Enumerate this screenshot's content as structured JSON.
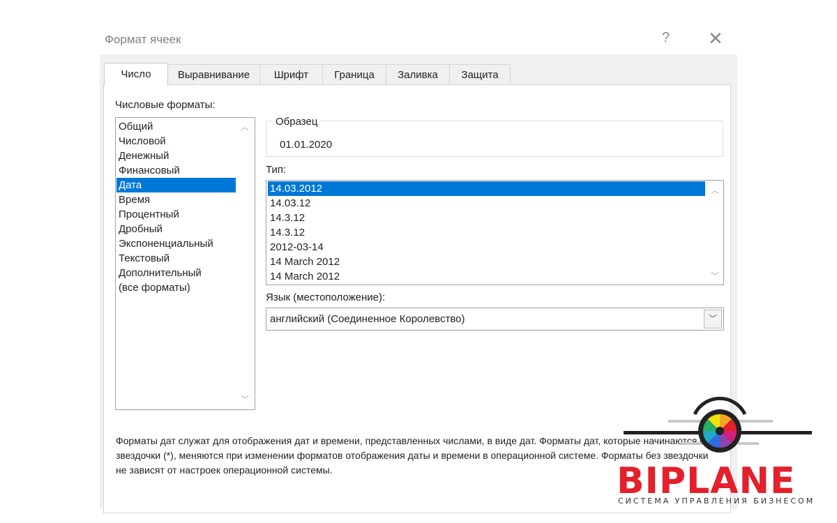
{
  "dialog": {
    "title": "Формат ячеек",
    "help_label": "?",
    "close_label": "✕"
  },
  "tabs": [
    {
      "label": "Число",
      "active": true
    },
    {
      "label": "Выравнивание",
      "active": false
    },
    {
      "label": "Шрифт",
      "active": false
    },
    {
      "label": "Граница",
      "active": false
    },
    {
      "label": "Заливка",
      "active": false
    },
    {
      "label": "Защита",
      "active": false
    }
  ],
  "categories": {
    "label": "Числовые форматы:",
    "items": [
      "Общий",
      "Числовой",
      "Денежный",
      "Финансовый",
      "Дата",
      "Время",
      "Процентный",
      "Дробный",
      "Экспоненциальный",
      "Текстовый",
      "Дополнительный",
      "(все форматы)"
    ],
    "selected": "Дата"
  },
  "sample": {
    "label": "Образец",
    "value": "01.01.2020"
  },
  "type": {
    "label": "Тип:",
    "items": [
      "14.03.2012",
      "14.03.12",
      "14.3.12",
      "14.3.12",
      "2012-03-14",
      "14 March 2012",
      "14 March 2012"
    ],
    "selected": "14.03.2012"
  },
  "locale": {
    "label": "Язык (местоположение):",
    "value": "английский (Соединенное Королевство)"
  },
  "description": "Форматы дат служат для отображения дат и времени, представленных числами, в виде дат. Форматы дат, которые начинаются со звездочки (*), меняются при изменении форматов отображения даты и времени в операционной системе. Форматы без звездочки не зависят от настроек операционной системы.",
  "watermark": {
    "brand": "BIPLANE",
    "tagline": "СИСТЕМА УПРАВЛЕНИЯ БИЗНЕСОМ",
    "colors": {
      "brand_red": "#e3202b",
      "dark": "#333333"
    }
  },
  "colors": {
    "selection": "#0078d7",
    "dialog_bg": "#f0f0f0",
    "panel_bg": "#ffffff"
  }
}
